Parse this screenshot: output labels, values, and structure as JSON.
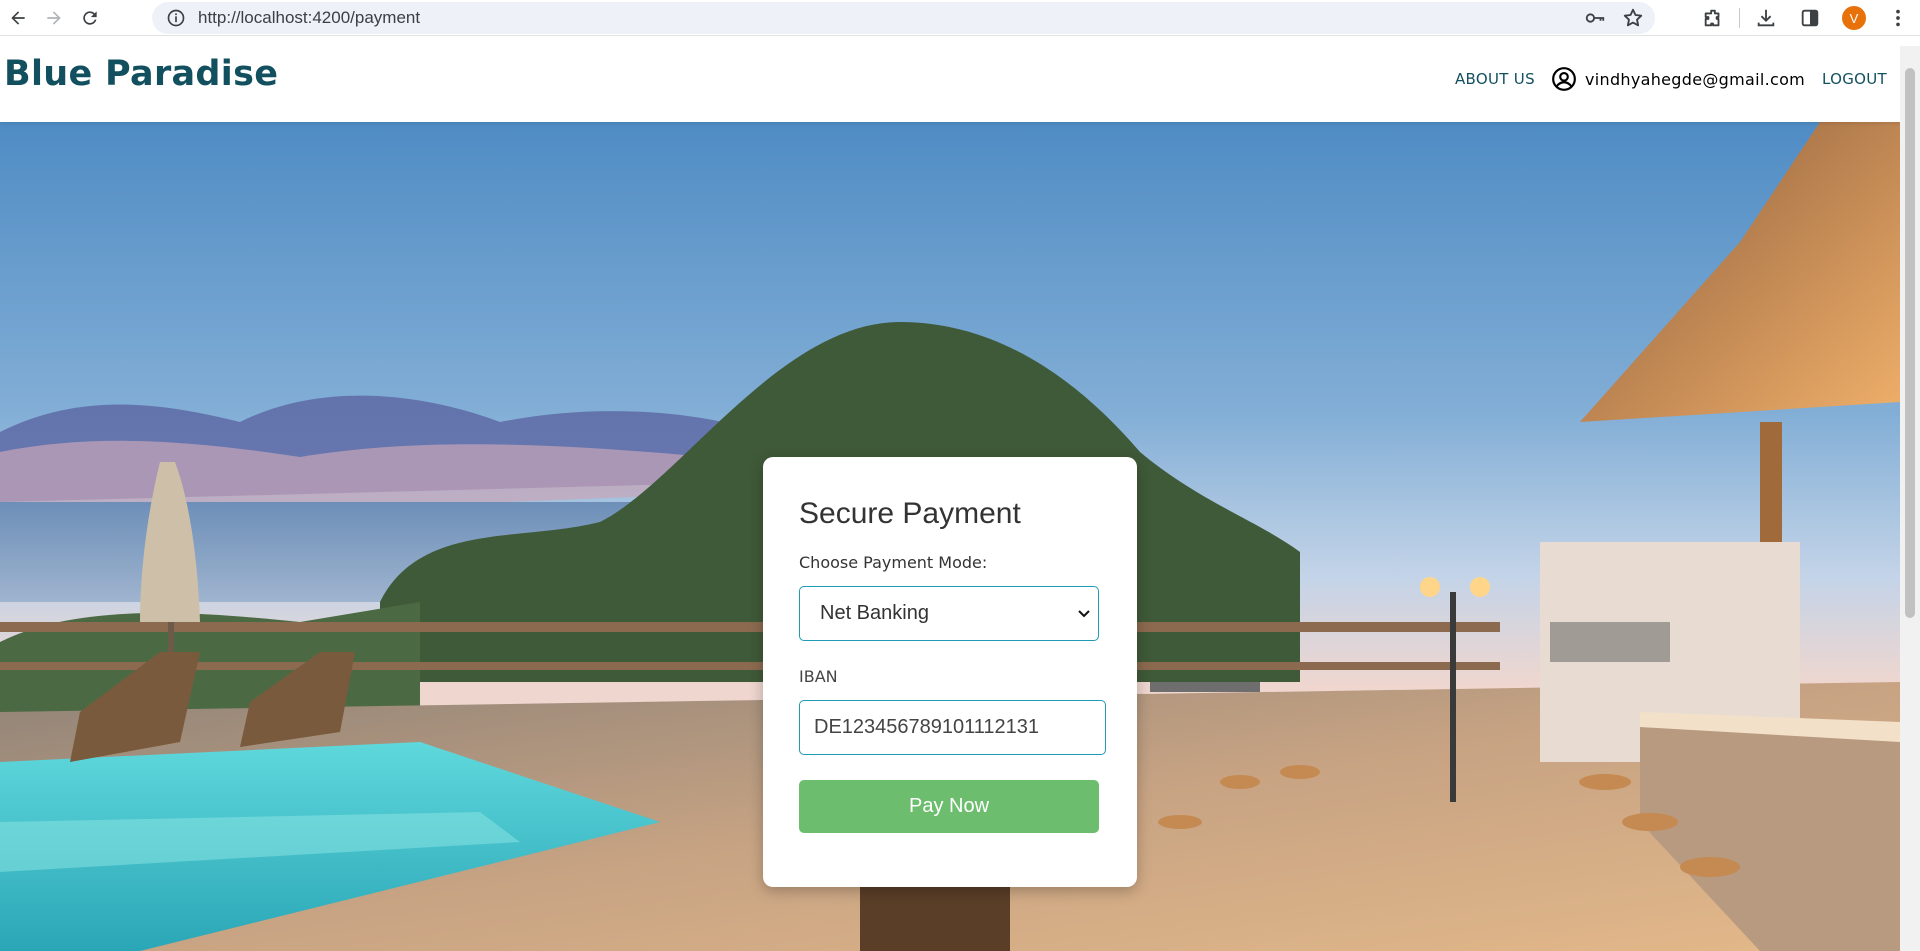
{
  "browser": {
    "url": "http://localhost:4200/payment",
    "profile_initial": "V"
  },
  "header": {
    "brand": "Blue Paradise",
    "about_label": "ABOUT US",
    "user_email": "vindhyahegde@gmail.com",
    "logout_label": "LOGOUT"
  },
  "payment": {
    "title": "Secure Payment",
    "mode_label": "Choose Payment Mode:",
    "mode_selected": "Net Banking",
    "iban_label": "IBAN",
    "iban_value": "DE123456789101112131",
    "pay_label": "Pay Now"
  },
  "colors": {
    "brand": "#12505f",
    "pay_button": "#6cbd6e",
    "input_border": "#1f9bb5"
  }
}
